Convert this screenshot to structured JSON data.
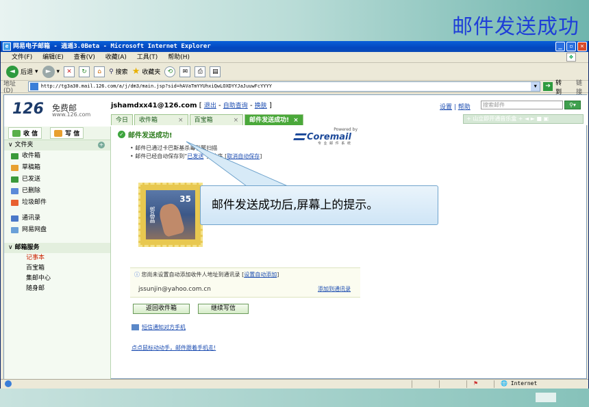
{
  "slide": {
    "title": "邮件发送成功"
  },
  "window": {
    "title": "网易电子邮箱 - 逍遥3.0Beta - Microsoft Internet Explorer"
  },
  "menu": [
    "文件(F)",
    "编辑(E)",
    "查看(V)",
    "收藏(A)",
    "工具(T)",
    "帮助(H)"
  ],
  "toolbar": {
    "back": "后退",
    "search": "搜索",
    "favorites": "收藏夹"
  },
  "address": {
    "label": "地址(D)",
    "url": "http://tg3a30.mail.126.com/a/j/dm3/main.jsp?sid=hAVaTmYYUhxiQwLOXDYYJaJuuwFcYYYY",
    "go": "转到",
    "links": "链接"
  },
  "mail": {
    "logo": "126",
    "logo_free": "免费邮",
    "logo_url": "www.126.com",
    "user": "jshamdxx41@126.com",
    "user_links": [
      "退出",
      "自助查询",
      "换肤"
    ],
    "top_links": [
      "设置",
      "帮助"
    ],
    "search_placeholder": "搜索邮件",
    "tabs": [
      "今日",
      "收件箱",
      "百宝箱",
      "邮件发送成功!"
    ],
    "ticker": "+ 山立即开通音乐盒 +  ◄ ► ■ ▣"
  },
  "sidebar": {
    "receive": "收 信",
    "write": "写 信",
    "folders_title": "文件夹",
    "folders": [
      "收件箱",
      "草稿箱",
      "已发送",
      "已删除",
      "垃圾邮件"
    ],
    "extra": [
      "通讯录",
      "网易网盘"
    ],
    "services_title": "邮箱服务",
    "services": [
      "记事本",
      "百宝箱",
      "集邮中心",
      "随身邮"
    ]
  },
  "main": {
    "success": "邮件发送成功!",
    "powered": "Powered by",
    "coremail": "Coremail",
    "coremail_sub": "专 业 邮 件 系 统",
    "note1": "• 邮件已通过卡巴斯基杀毒引擎扫描",
    "note2_pre": "• 邮件已经自动保存到“",
    "note2_link": "已发送",
    "note2_mid": "”文件夹 [",
    "note2_link2": "取消自动保存",
    "note2_post": "]",
    "stamp_value": "35",
    "stamp_chars": "郭晶晶",
    "auto_text": "您尚未设置自动添加收件人地址到通讯录 [",
    "auto_link": "设置自动添加",
    "auto_close": "]",
    "recipient": "jssunjin@yahoo.com.cn",
    "add_contact": "添加到通讯录",
    "btn_back": "返回收件箱",
    "btn_continue": "继续写信",
    "sms": "短信通知对方手机",
    "promo": "点点鼠标动动手，邮件跟着手机走!"
  },
  "callout": {
    "text": "邮件发送成功后,屏幕上的提示。"
  },
  "status": {
    "zone": "Internet"
  },
  "colors": {
    "title_blue": "#1f3fd8",
    "success_green": "#2a7a1a",
    "link": "#1a4bb0"
  }
}
